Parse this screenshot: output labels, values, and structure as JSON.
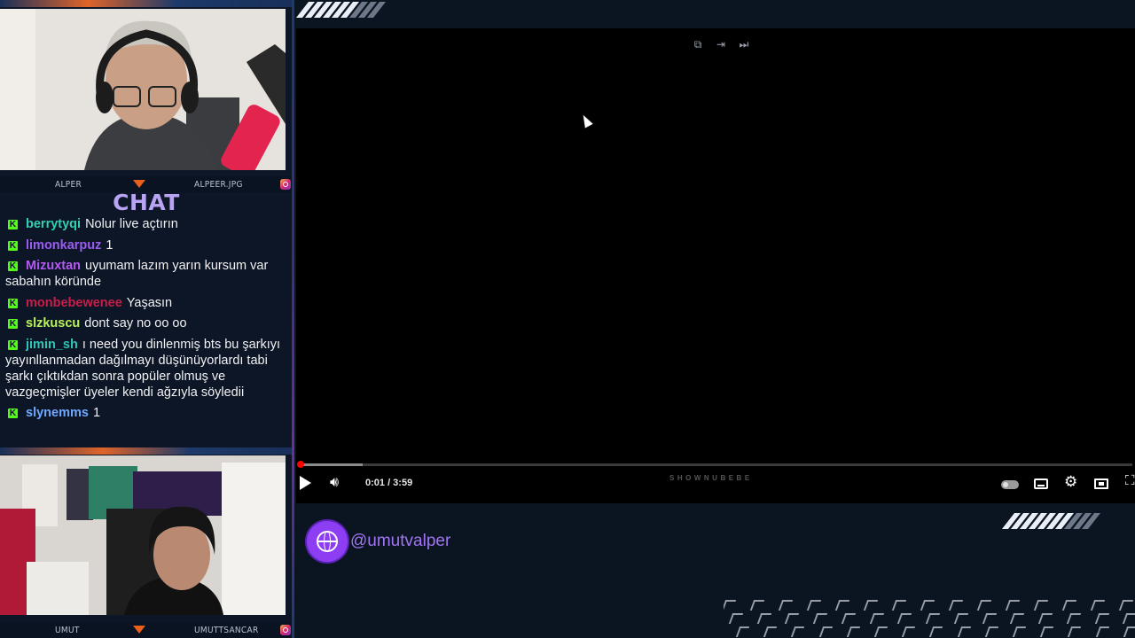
{
  "top_camera": {
    "left_name": "ALPER",
    "right_name": "ALPEER.JPG"
  },
  "bottom_camera": {
    "left_name": "UMUT",
    "right_name": "UMUTTSANCAR"
  },
  "chat": {
    "title": "CHAT",
    "badge_glyph": "K",
    "messages": [
      {
        "user": "berrytyqi",
        "color": "#31d0b3",
        "text": "Nolur live açtırın"
      },
      {
        "user": "limonkarpuz",
        "color": "#9b5cf0",
        "text": "1"
      },
      {
        "user": "Mizuxtan",
        "color": "#b45af2",
        "text": "uyumam lazım yarın kursum var sabahın köründe"
      },
      {
        "user": "monbebewenee",
        "color": "#c81e4a",
        "text": "Yaşasın"
      },
      {
        "user": "slzkuscu",
        "color": "#b8f25a",
        "text": "dont say no oo oo"
      },
      {
        "user": "jimin_sh",
        "color": "#2ec4b6",
        "text": "ı need you dinlenmiş bts bu şarkıyı yayınllanmadan dağılmayı düşünüyorlardı tabi şarkı çıktıkdan sonra popüler olmuş ve vazgeçmişler üyeler kendi ağzıyla söyledii"
      },
      {
        "user": "slynemms",
        "color": "#6fa8ff",
        "text": "1"
      }
    ]
  },
  "player": {
    "top_icons": [
      "external-link-icon",
      "enter-icon",
      "skip-next-icon"
    ],
    "current_time": "0:01 / 3:59",
    "watermark": "SHOWNUBEBE",
    "progress_percent": 0.4,
    "buffered_percent": 7.7,
    "controls": [
      "play-icon",
      "volume-icon",
      "autoplay-toggle",
      "captions-icon",
      "settings-icon",
      "miniplayer-icon",
      "fullscreen-icon"
    ]
  },
  "social": {
    "handle": "@umutvalper",
    "icon": "globe-icon"
  },
  "colors": {
    "background": "#0b1421",
    "accent_purple": "#8d3ef2",
    "kick_green": "#53fc18",
    "progress_red": "#ff0000"
  }
}
